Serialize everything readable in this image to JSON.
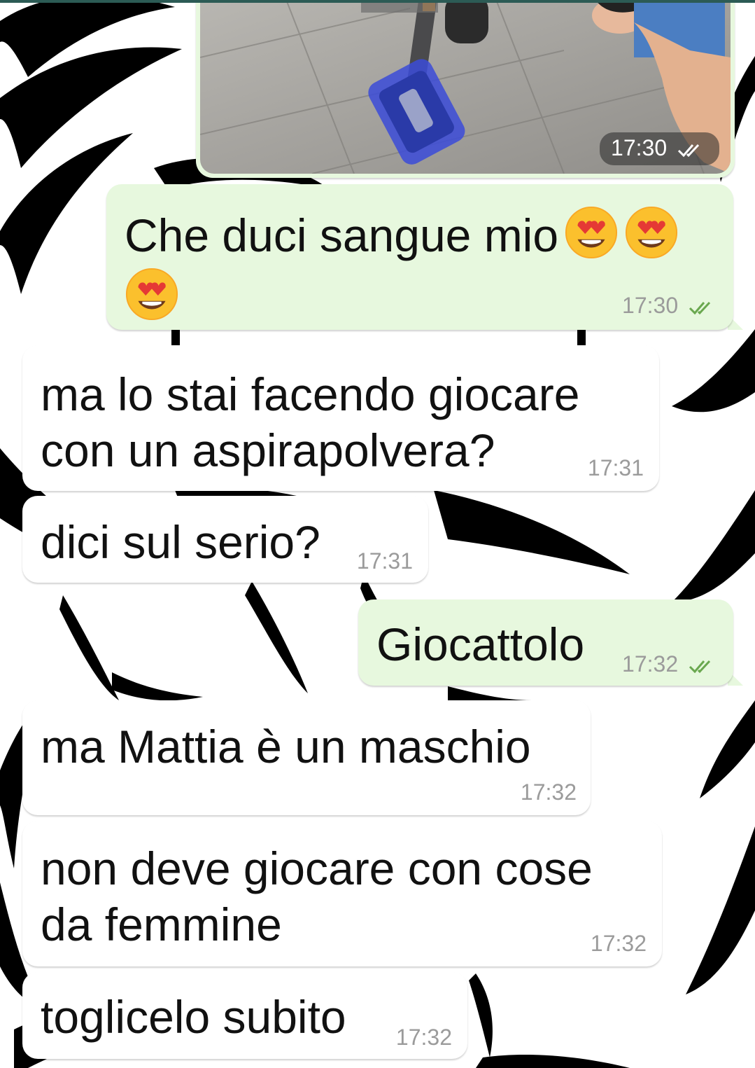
{
  "colors": {
    "incoming_bubble": "#ffffff",
    "outgoing_bubble": "#e7f8de",
    "read_ticks": "#4fc3f7",
    "sent_ticks_on_photo": "#ffffff",
    "timestamp": "#9b9b9b"
  },
  "photo_message": {
    "time": "17:30",
    "status_icon": "double-check-icon"
  },
  "messages": [
    {
      "direction": "out",
      "text": "Che duci sangue mio",
      "emoji": [
        "heart-eyes-emoji",
        "heart-eyes-emoji",
        "heart-eyes-emoji"
      ],
      "time": "17:30",
      "status_icon": "double-check-icon"
    },
    {
      "direction": "in",
      "text": "ma lo stai facendo giocare con un aspirapolvera?",
      "time": "17:31"
    },
    {
      "direction": "in",
      "text": "dici sul serio?",
      "time": "17:31"
    },
    {
      "direction": "out",
      "text": "Giocattolo",
      "time": "17:32",
      "status_icon": "double-check-icon"
    },
    {
      "direction": "in",
      "text": "ma Mattia è un maschio",
      "time": "17:32"
    },
    {
      "direction": "in",
      "text": "non deve giocare con cose da femmine",
      "time": "17:32"
    },
    {
      "direction": "in",
      "text": "toglicelo subito",
      "time": "17:32"
    }
  ]
}
